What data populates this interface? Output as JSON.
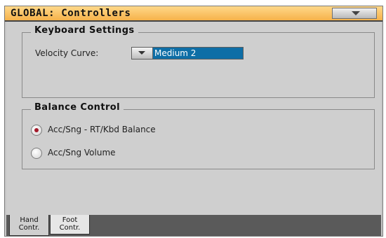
{
  "window": {
    "title": "GLOBAL: Controllers"
  },
  "keyboard_settings": {
    "title": "Keyboard Settings",
    "velocity_label": "Velocity Curve:",
    "velocity_value": "Medium 2"
  },
  "balance_control": {
    "title": "Balance Control",
    "options": [
      {
        "label": "Acc/Sng - RT/Kbd  Balance",
        "selected": true
      },
      {
        "label": "Acc/Sng Volume",
        "selected": false
      }
    ]
  },
  "tabs": [
    {
      "line1": "Hand",
      "line2": "Contr.",
      "active": true
    },
    {
      "line1": "Foot",
      "line2": "Contr.",
      "active": false
    }
  ],
  "colors": {
    "title_bar": "#f6b24a",
    "selected_value_bg": "#0e6ea6",
    "radio_dot": "#a3192a"
  }
}
